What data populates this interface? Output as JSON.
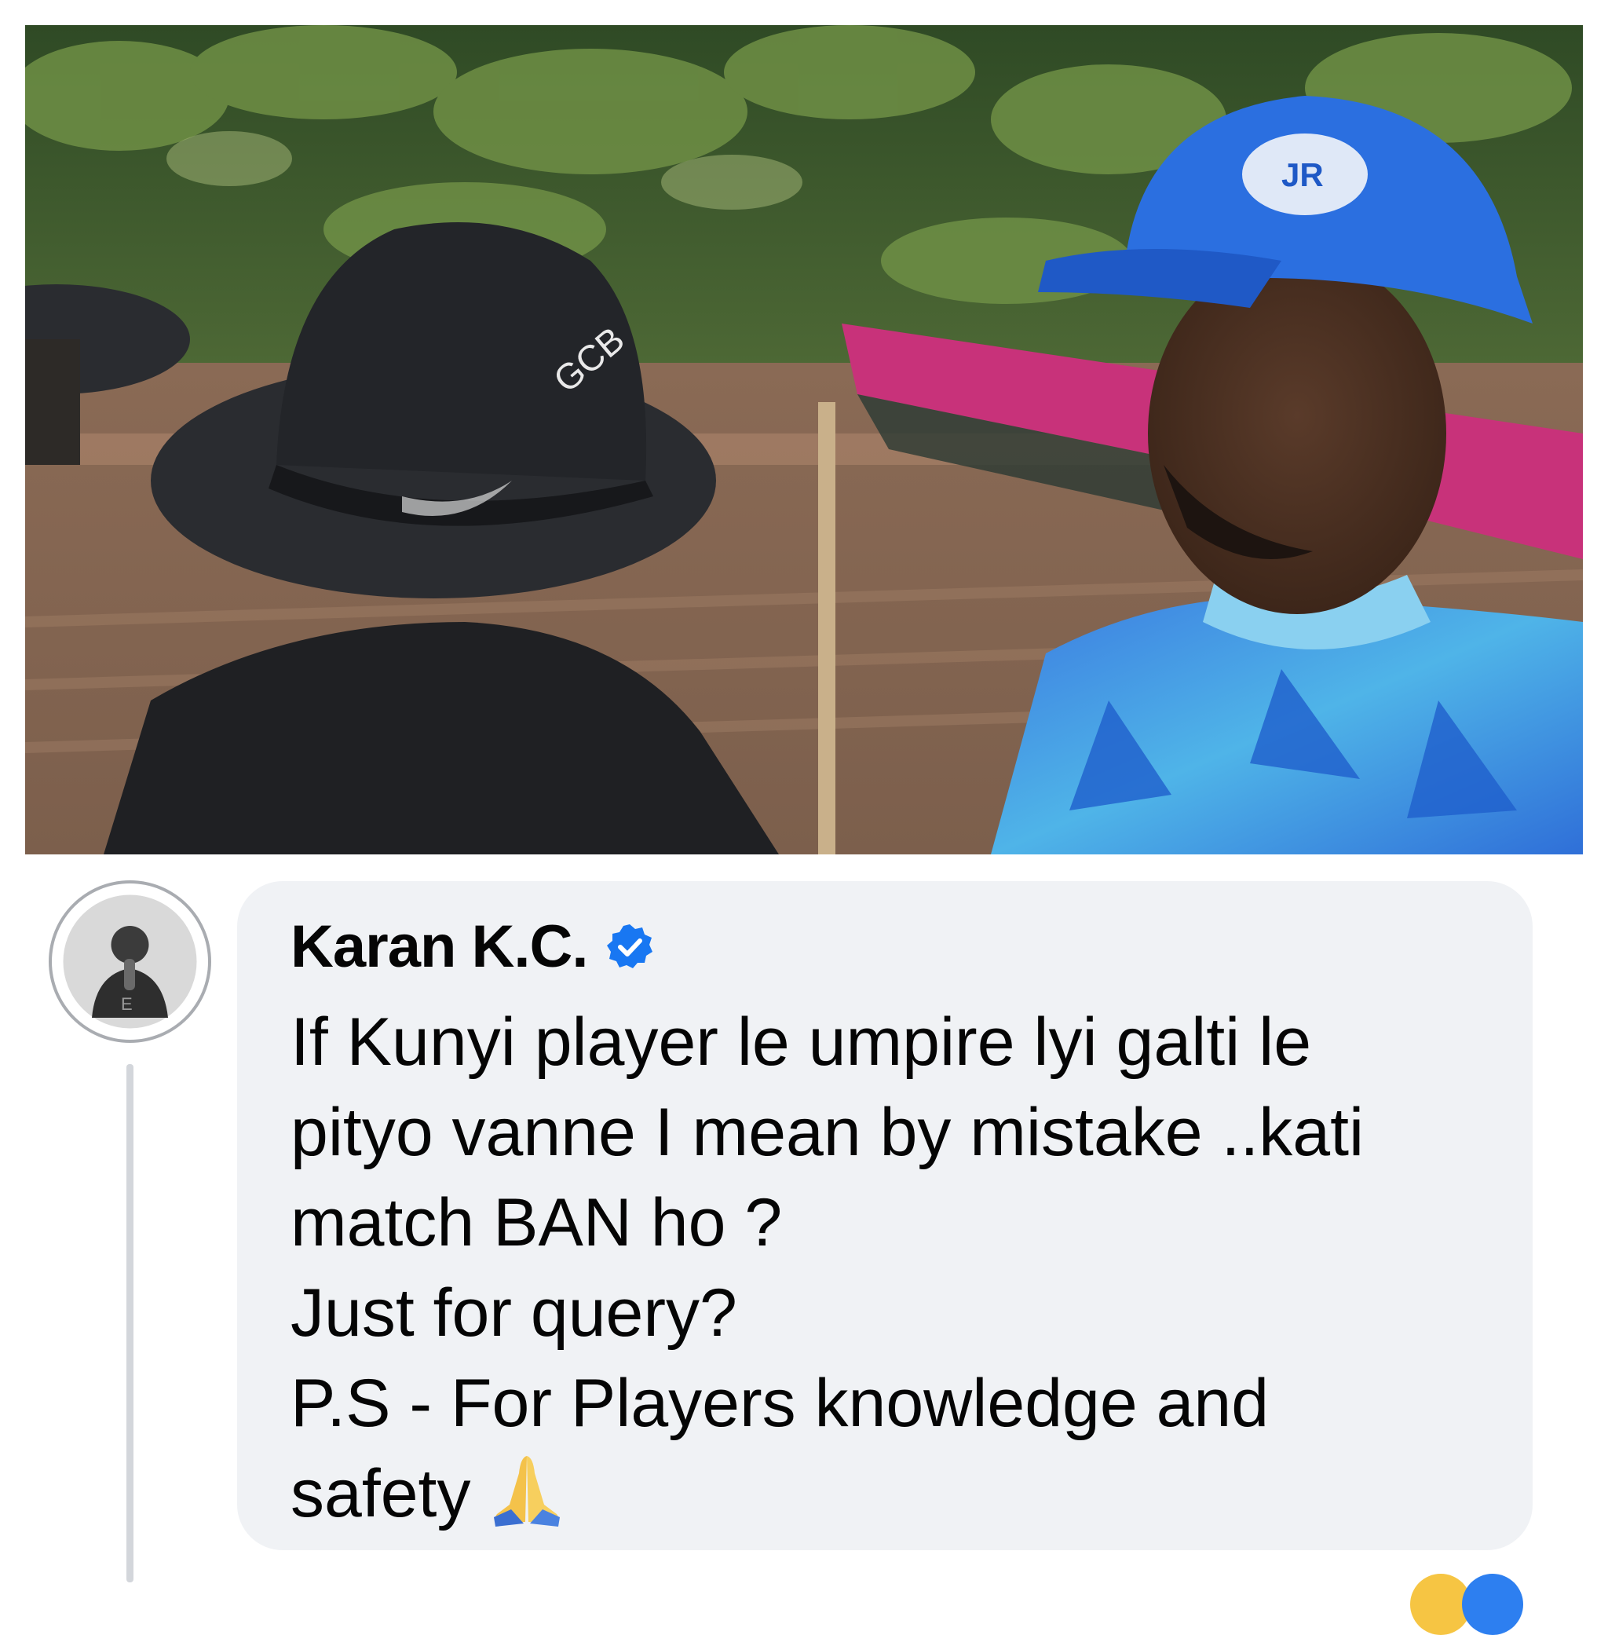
{
  "comment": {
    "author": "Karan K.C.",
    "verified_icon": "verified-badge-icon",
    "lines": [
      "If Kunyi player le umpire lyi galti le",
      "pityo vanne I mean by mistake ..kati",
      "match BAN ho ?",
      "Just for query?",
      "P.S - For Players knowledge and",
      "safety"
    ],
    "emoji": "folded-hands-icon"
  },
  "colors": {
    "bubble": "#f0f2f5",
    "verified": "#1877f2",
    "text": "#050505",
    "thread_line": "#d3d6db"
  }
}
